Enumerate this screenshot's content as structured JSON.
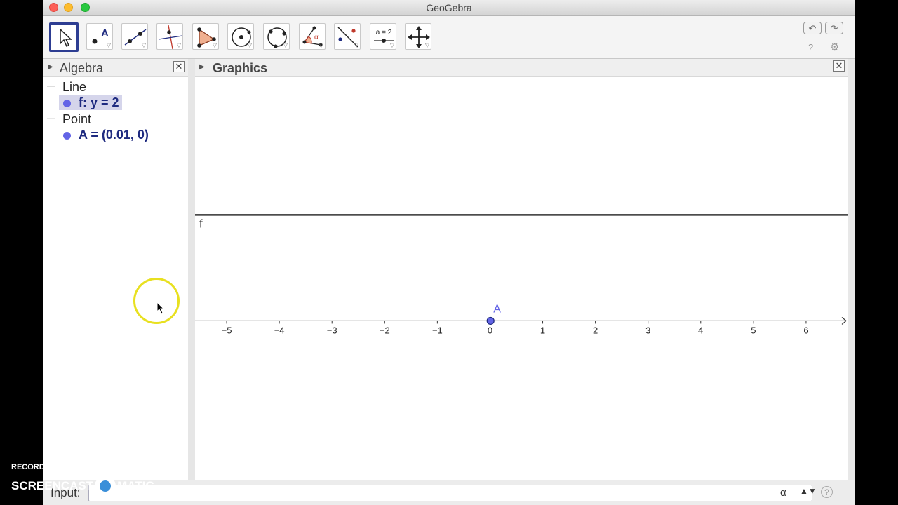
{
  "window": {
    "title": "GeoGebra"
  },
  "toolbar": {
    "tools": [
      {
        "name": "move-tool",
        "selected": true
      },
      {
        "name": "point-tool",
        "label": "A"
      },
      {
        "name": "line-tool"
      },
      {
        "name": "perpendicular-line-tool"
      },
      {
        "name": "polygon-tool"
      },
      {
        "name": "circle-center-point-tool"
      },
      {
        "name": "circle-three-points-tool"
      },
      {
        "name": "angle-tool",
        "label": "α"
      },
      {
        "name": "reflect-tool"
      },
      {
        "name": "slider-tool",
        "label": "a = 2"
      },
      {
        "name": "move-graphics-view-tool"
      }
    ]
  },
  "algebra": {
    "title": "Algebra",
    "categories": [
      {
        "name": "Line",
        "items": [
          {
            "text": "f: y = 2",
            "selected": true
          }
        ]
      },
      {
        "name": "Point",
        "items": [
          {
            "text": "A = (0.01, 0)",
            "selected": false
          }
        ]
      }
    ]
  },
  "graphics": {
    "title": "Graphics",
    "line_label": "f",
    "line_y": 2,
    "point": {
      "label": "A",
      "x": 0.01,
      "y": 0
    },
    "x_ticks": [
      -5,
      -4,
      -3,
      -2,
      -1,
      0,
      1,
      2,
      3,
      4,
      5,
      6
    ],
    "x_range": [
      -5.6,
      6.8
    ],
    "y_range": [
      -3,
      4.6
    ]
  },
  "input": {
    "label": "Input:",
    "value": "",
    "alpha": "α"
  },
  "watermark": {
    "top": "RECORDED WITH",
    "left": "SCREENCAST",
    "right": "MATIC"
  },
  "colors": {
    "point": "#6364e6",
    "algebra_text": "#1f2b80",
    "selection": "#d5d5eb",
    "highlight_ring": "#e8e020"
  }
}
